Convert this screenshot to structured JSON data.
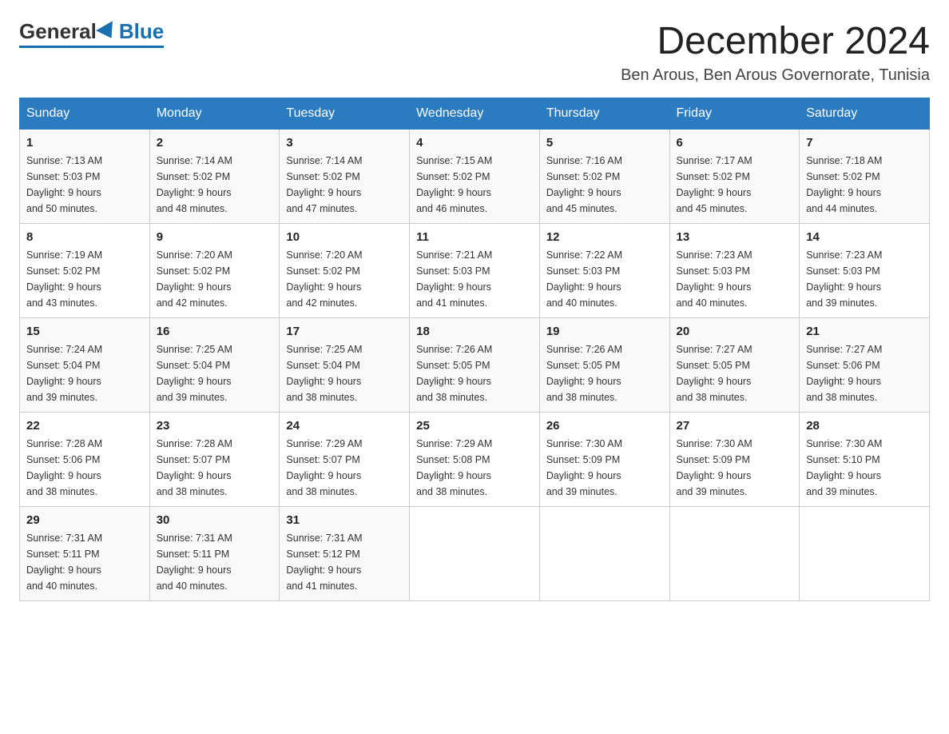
{
  "logo": {
    "general": "General",
    "blue": "Blue"
  },
  "title": "December 2024",
  "subtitle": "Ben Arous, Ben Arous Governorate, Tunisia",
  "headers": [
    "Sunday",
    "Monday",
    "Tuesday",
    "Wednesday",
    "Thursday",
    "Friday",
    "Saturday"
  ],
  "weeks": [
    [
      {
        "day": "1",
        "sunrise": "7:13 AM",
        "sunset": "5:03 PM",
        "daylight": "9 hours and 50 minutes."
      },
      {
        "day": "2",
        "sunrise": "7:14 AM",
        "sunset": "5:02 PM",
        "daylight": "9 hours and 48 minutes."
      },
      {
        "day": "3",
        "sunrise": "7:14 AM",
        "sunset": "5:02 PM",
        "daylight": "9 hours and 47 minutes."
      },
      {
        "day": "4",
        "sunrise": "7:15 AM",
        "sunset": "5:02 PM",
        "daylight": "9 hours and 46 minutes."
      },
      {
        "day": "5",
        "sunrise": "7:16 AM",
        "sunset": "5:02 PM",
        "daylight": "9 hours and 45 minutes."
      },
      {
        "day": "6",
        "sunrise": "7:17 AM",
        "sunset": "5:02 PM",
        "daylight": "9 hours and 45 minutes."
      },
      {
        "day": "7",
        "sunrise": "7:18 AM",
        "sunset": "5:02 PM",
        "daylight": "9 hours and 44 minutes."
      }
    ],
    [
      {
        "day": "8",
        "sunrise": "7:19 AM",
        "sunset": "5:02 PM",
        "daylight": "9 hours and 43 minutes."
      },
      {
        "day": "9",
        "sunrise": "7:20 AM",
        "sunset": "5:02 PM",
        "daylight": "9 hours and 42 minutes."
      },
      {
        "day": "10",
        "sunrise": "7:20 AM",
        "sunset": "5:02 PM",
        "daylight": "9 hours and 42 minutes."
      },
      {
        "day": "11",
        "sunrise": "7:21 AM",
        "sunset": "5:03 PM",
        "daylight": "9 hours and 41 minutes."
      },
      {
        "day": "12",
        "sunrise": "7:22 AM",
        "sunset": "5:03 PM",
        "daylight": "9 hours and 40 minutes."
      },
      {
        "day": "13",
        "sunrise": "7:23 AM",
        "sunset": "5:03 PM",
        "daylight": "9 hours and 40 minutes."
      },
      {
        "day": "14",
        "sunrise": "7:23 AM",
        "sunset": "5:03 PM",
        "daylight": "9 hours and 39 minutes."
      }
    ],
    [
      {
        "day": "15",
        "sunrise": "7:24 AM",
        "sunset": "5:04 PM",
        "daylight": "9 hours and 39 minutes."
      },
      {
        "day": "16",
        "sunrise": "7:25 AM",
        "sunset": "5:04 PM",
        "daylight": "9 hours and 39 minutes."
      },
      {
        "day": "17",
        "sunrise": "7:25 AM",
        "sunset": "5:04 PM",
        "daylight": "9 hours and 38 minutes."
      },
      {
        "day": "18",
        "sunrise": "7:26 AM",
        "sunset": "5:05 PM",
        "daylight": "9 hours and 38 minutes."
      },
      {
        "day": "19",
        "sunrise": "7:26 AM",
        "sunset": "5:05 PM",
        "daylight": "9 hours and 38 minutes."
      },
      {
        "day": "20",
        "sunrise": "7:27 AM",
        "sunset": "5:05 PM",
        "daylight": "9 hours and 38 minutes."
      },
      {
        "day": "21",
        "sunrise": "7:27 AM",
        "sunset": "5:06 PM",
        "daylight": "9 hours and 38 minutes."
      }
    ],
    [
      {
        "day": "22",
        "sunrise": "7:28 AM",
        "sunset": "5:06 PM",
        "daylight": "9 hours and 38 minutes."
      },
      {
        "day": "23",
        "sunrise": "7:28 AM",
        "sunset": "5:07 PM",
        "daylight": "9 hours and 38 minutes."
      },
      {
        "day": "24",
        "sunrise": "7:29 AM",
        "sunset": "5:07 PM",
        "daylight": "9 hours and 38 minutes."
      },
      {
        "day": "25",
        "sunrise": "7:29 AM",
        "sunset": "5:08 PM",
        "daylight": "9 hours and 38 minutes."
      },
      {
        "day": "26",
        "sunrise": "7:30 AM",
        "sunset": "5:09 PM",
        "daylight": "9 hours and 39 minutes."
      },
      {
        "day": "27",
        "sunrise": "7:30 AM",
        "sunset": "5:09 PM",
        "daylight": "9 hours and 39 minutes."
      },
      {
        "day": "28",
        "sunrise": "7:30 AM",
        "sunset": "5:10 PM",
        "daylight": "9 hours and 39 minutes."
      }
    ],
    [
      {
        "day": "29",
        "sunrise": "7:31 AM",
        "sunset": "5:11 PM",
        "daylight": "9 hours and 40 minutes."
      },
      {
        "day": "30",
        "sunrise": "7:31 AM",
        "sunset": "5:11 PM",
        "daylight": "9 hours and 40 minutes."
      },
      {
        "day": "31",
        "sunrise": "7:31 AM",
        "sunset": "5:12 PM",
        "daylight": "9 hours and 41 minutes."
      },
      null,
      null,
      null,
      null
    ]
  ],
  "labels": {
    "sunrise": "Sunrise:",
    "sunset": "Sunset:",
    "daylight": "Daylight:"
  }
}
